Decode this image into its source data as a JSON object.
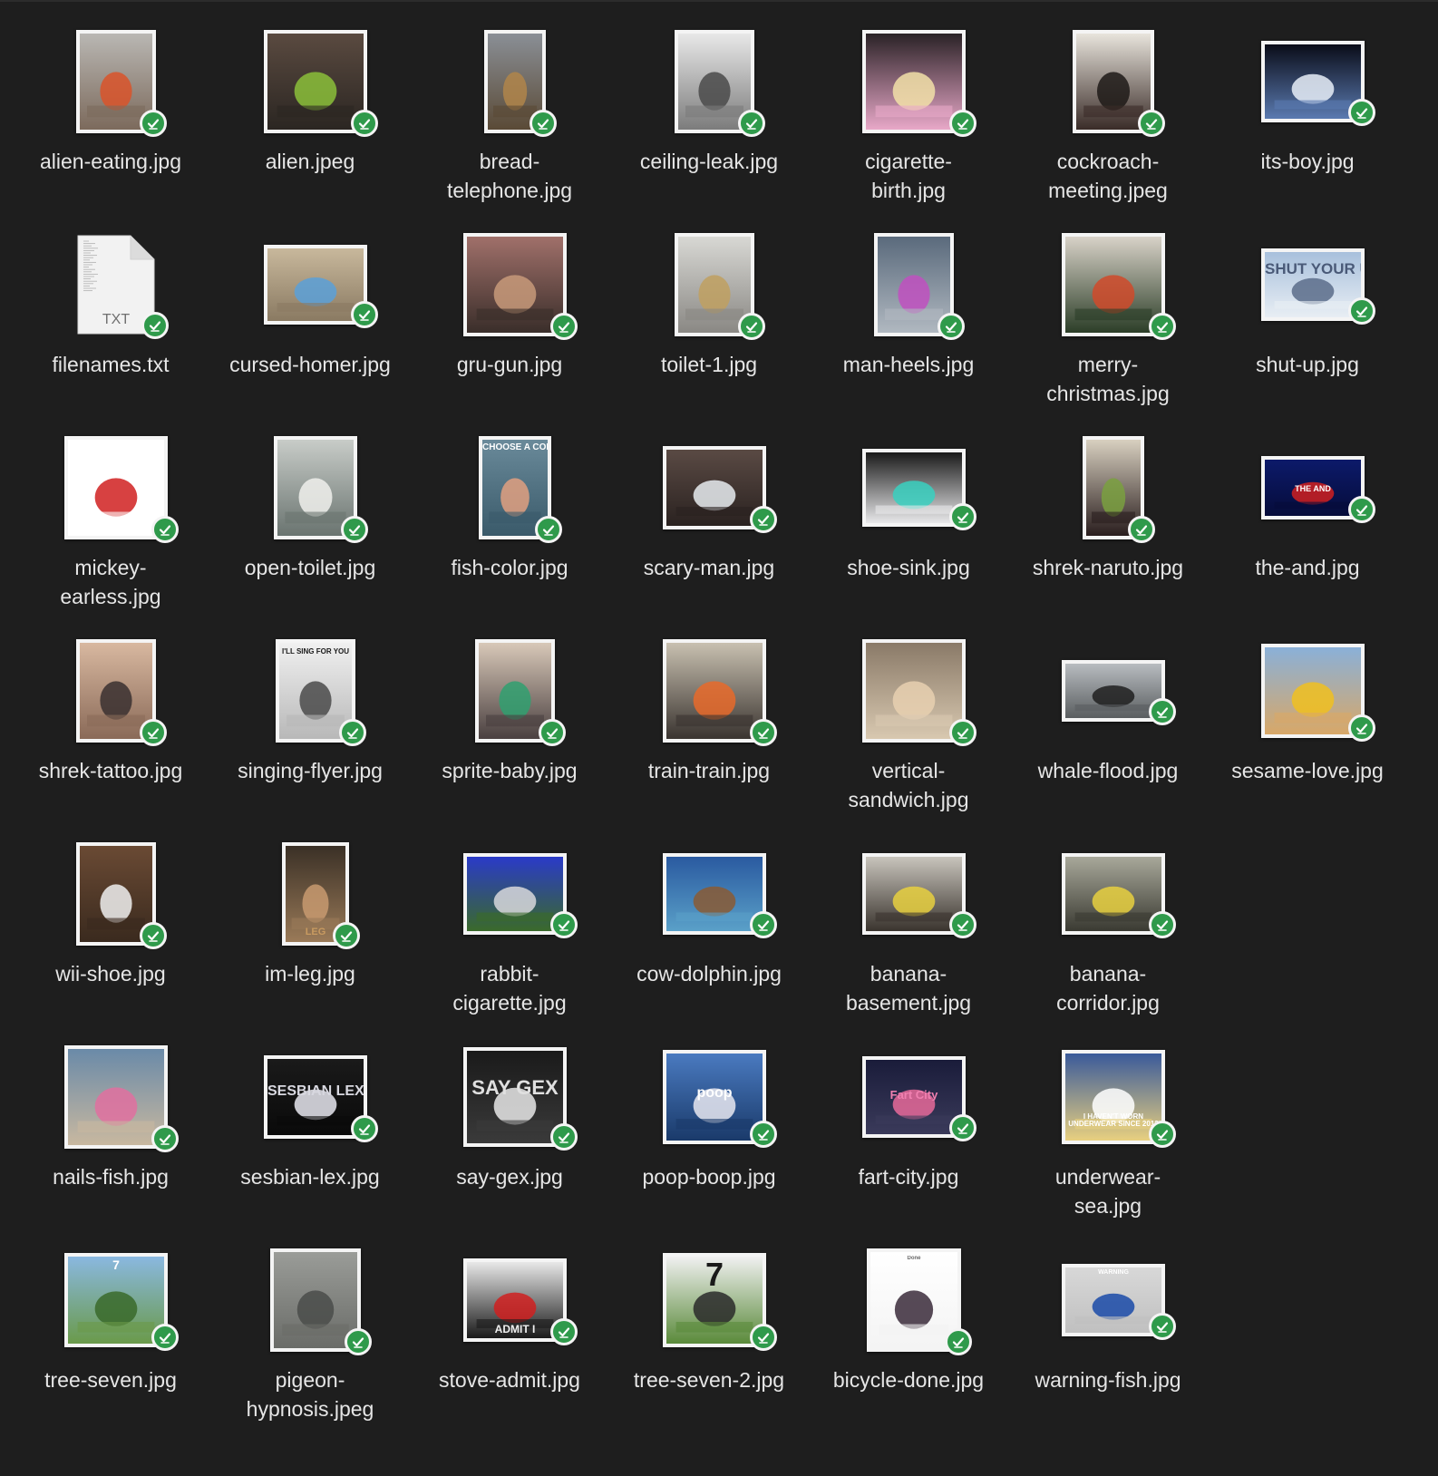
{
  "window": {
    "background": "#1e1e1e"
  },
  "files": [
    {
      "name": "alien-eating.jpg",
      "display": "alien-eating.jpg",
      "w": 88,
      "h": 114,
      "bg": [
        "#b9b7b3",
        "#7c6a5c"
      ],
      "accent": "#d9542a",
      "icon": "alien-eating-thumbnail",
      "selected": true
    },
    {
      "name": "alien.jpeg",
      "display": "alien.jpeg",
      "w": 114,
      "h": 114,
      "bg": [
        "#5a4a40",
        "#2b2622"
      ],
      "accent": "#8bbf3a",
      "icon": "alien-thumbnail",
      "selected": true
    },
    {
      "name": "bread-telephone.jpg",
      "display": "bread-\ntelephone.jpg",
      "w": 68,
      "h": 114,
      "bg": [
        "#8a8f96",
        "#5a4a36"
      ],
      "accent": "#b0854a",
      "icon": "bread-telephone-thumbnail",
      "selected": true
    },
    {
      "name": "ceiling-leak.jpg",
      "display": "ceiling-leak.jpg",
      "w": 88,
      "h": 114,
      "bg": [
        "#e8e8e8",
        "#7c7c7c"
      ],
      "accent": "#4a4a4a",
      "icon": "ceiling-leak-thumbnail",
      "selected": true
    },
    {
      "name": "cigarette-birth.jpg",
      "display": "cigarette-\nbirth.jpg",
      "w": 114,
      "h": 114,
      "bg": [
        "#2a2226",
        "#e8a8c8"
      ],
      "accent": "#f2e0a8",
      "icon": "cigarette-birth-thumbnail",
      "selected": true
    },
    {
      "name": "cockroach-meeting.jpeg",
      "display": "cockroach-\nmeeting.jpeg",
      "w": 90,
      "h": 114,
      "bg": [
        "#e8e4dc",
        "#3a2c28"
      ],
      "accent": "#1e1a18",
      "icon": "cockroach-meeting-thumbnail",
      "selected": true
    },
    {
      "name": "its-boy.jpg",
      "display": "its-boy.jpg",
      "w": 114,
      "h": 90,
      "bg": [
        "#0a0c18",
        "#5a7ab0"
      ],
      "accent": "#e8eef8",
      "icon": "its-boy-thumbnail",
      "selected": true
    },
    {
      "name": "filenames.txt",
      "display": "filenames.txt",
      "type": "txt",
      "ext": "TXT",
      "icon": "text-document-icon",
      "selected": true
    },
    {
      "name": "cursed-homer.jpg",
      "display": "cursed-homer.jpg",
      "w": 114,
      "h": 88,
      "bg": [
        "#c8b89c",
        "#8a7a62"
      ],
      "accent": "#5aa0d8",
      "icon": "cursed-homer-thumbnail",
      "selected": true
    },
    {
      "name": "gru-gun.jpg",
      "display": "gru-gun.jpg",
      "w": 114,
      "h": 114,
      "bg": [
        "#a0706a",
        "#3a2e2a"
      ],
      "accent": "#c89a7a",
      "icon": "gru-gun-thumbnail",
      "selected": true
    },
    {
      "name": "toilet-1.jpg",
      "display": "toilet-1.jpg",
      "w": 88,
      "h": 114,
      "bg": [
        "#d8d8d4",
        "#8a8884"
      ],
      "accent": "#c0a060",
      "icon": "toilet-thumbnail",
      "selected": true
    },
    {
      "name": "man-heels.jpg",
      "display": "man-heels.jpg",
      "w": 88,
      "h": 114,
      "bg": [
        "#5a6a7c",
        "#b0b8c0"
      ],
      "accent": "#c050c0",
      "icon": "man-heels-thumbnail",
      "selected": true
    },
    {
      "name": "merry-christmas.jpg",
      "display": "merry-\nchristmas.jpg",
      "w": 114,
      "h": 114,
      "bg": [
        "#d8d2c8",
        "#2c3e28"
      ],
      "accent": "#d04a2a",
      "icon": "merry-christmas-thumbnail",
      "selected": true
    },
    {
      "name": "shut-up.jpg",
      "display": "shut-up.jpg",
      "w": 114,
      "h": 80,
      "bg": [
        "#a8c0dc",
        "#e8eef4"
      ],
      "accent": "#5a6c8a",
      "icon": "shut-up-thumbnail",
      "label": "SHUT YOUR UP",
      "labelColor": "#4a5a78",
      "labelSize": 17,
      "labelTop": 10,
      "selected": true
    },
    {
      "name": "mickey-earless.jpg",
      "display": "mickey-\nearless.jpg",
      "w": 114,
      "h": 114,
      "bg": [
        "#ffffff",
        "#ffffff"
      ],
      "accent": "#d02020",
      "icon": "mickey-earless-thumbnail",
      "selected": true
    },
    {
      "name": "open-toilet.jpg",
      "display": "open-toilet.jpg",
      "w": 92,
      "h": 114,
      "bg": [
        "#c8ccc8",
        "#6a7470"
      ],
      "accent": "#f0f0ec",
      "icon": "open-toilet-thumbnail",
      "selected": true
    },
    {
      "name": "fish-color.jpg",
      "display": "fish-color.jpg",
      "w": 80,
      "h": 114,
      "bg": [
        "#6a8a9a",
        "#3a5a6a"
      ],
      "accent": "#e0a080",
      "icon": "fish-color-thumbnail",
      "label": "CHOOSE A COLOR",
      "labelColor": "#ffffff",
      "labelSize": 10,
      "labelTop": 4,
      "selected": true
    },
    {
      "name": "scary-man.jpg",
      "display": "scary-man.jpg",
      "w": 114,
      "h": 92,
      "bg": [
        "#5a4a44",
        "#2a2220"
      ],
      "accent": "#e8ecf0",
      "icon": "scary-man-thumbnail",
      "selected": true
    },
    {
      "name": "shoe-sink.jpg",
      "display": "shoe-sink.jpg",
      "w": 114,
      "h": 86,
      "bg": [
        "#1a1a1a",
        "#e8e8ea"
      ],
      "accent": "#38d0c0",
      "icon": "shoe-sink-thumbnail",
      "selected": true
    },
    {
      "name": "shrek-naruto.jpg",
      "display": "shrek-naruto.jpg",
      "w": 68,
      "h": 114,
      "bg": [
        "#d8d0c0",
        "#2a1e1e"
      ],
      "accent": "#7aa040",
      "icon": "shrek-naruto-thumbnail",
      "selected": true
    },
    {
      "name": "the-and.jpg",
      "display": "the-and.jpg",
      "w": 114,
      "h": 70,
      "bg": [
        "#0c1a6a",
        "#060c3a"
      ],
      "accent": "#d02020",
      "icon": "the-and-thumbnail",
      "label": "THE AND",
      "labelColor": "#ffffff",
      "labelSize": 9,
      "labelTop": 28,
      "selected": true
    },
    {
      "name": "shrek-tattoo.jpg",
      "display": "shrek-tattoo.jpg",
      "w": 88,
      "h": 114,
      "bg": [
        "#d8b8a0",
        "#8a6a58"
      ],
      "accent": "#3a3030",
      "icon": "shrek-tattoo-thumbnail",
      "selected": true
    },
    {
      "name": "singing-flyer.jpg",
      "display": "singing-flyer.jpg",
      "w": 88,
      "h": 114,
      "bg": [
        "#f0f0f0",
        "#b8b8b8"
      ],
      "accent": "#4a4a4a",
      "icon": "singing-flyer-thumbnail",
      "label": "I'LL SING FOR YOU",
      "labelColor": "#1a1a1a",
      "labelSize": 8,
      "labelTop": 6,
      "selected": true
    },
    {
      "name": "sprite-baby.jpg",
      "display": "sprite-baby.jpg",
      "w": 88,
      "h": 114,
      "bg": [
        "#d8c8b8",
        "#4a4040"
      ],
      "accent": "#30a070",
      "icon": "sprite-baby-thumbnail",
      "selected": true
    },
    {
      "name": "train-train.jpg",
      "display": "train-train.jpg",
      "w": 114,
      "h": 114,
      "bg": [
        "#c8c0b0",
        "#3a3430"
      ],
      "accent": "#e86a2a",
      "icon": "train-train-thumbnail",
      "selected": true
    },
    {
      "name": "vertical-sandwich.jpg",
      "display": "vertical-\nsandwich.jpg",
      "w": 114,
      "h": 114,
      "bg": [
        "#8a7a68",
        "#d8c8b0"
      ],
      "accent": "#e8d0b0",
      "icon": "vertical-sandwich-thumbnail",
      "selected": true
    },
    {
      "name": "whale-flood.jpg",
      "display": "whale-flood.jpg",
      "w": 114,
      "h": 68,
      "bg": [
        "#b8bcc0",
        "#5a5e60"
      ],
      "accent": "#202020",
      "icon": "whale-flood-thumbnail",
      "selected": true
    },
    {
      "name": "sesame-love.jpg",
      "display": "sesame-love.jpg",
      "w": 114,
      "h": 104,
      "bg": [
        "#8ab0d8",
        "#d8a868"
      ],
      "accent": "#f0c020",
      "icon": "sesame-love-thumbnail",
      "selected": true
    },
    {
      "name": "wii-shoe.jpg",
      "display": "wii-shoe.jpg",
      "w": 88,
      "h": 114,
      "bg": [
        "#6a4a34",
        "#3a2a1e"
      ],
      "accent": "#f0f0f0",
      "icon": "wii-shoe-thumbnail",
      "selected": true
    },
    {
      "name": "im-leg.jpg",
      "display": "im-leg.jpg",
      "w": 74,
      "h": 114,
      "bg": [
        "#3a3026",
        "#9a7a58"
      ],
      "accent": "#c89a70",
      "icon": "im-leg-thumbnail",
      "label": "LEG",
      "labelColor": "#c89a60",
      "labelSize": 11,
      "labelTop": 90,
      "selected": true
    },
    {
      "name": "rabbit-cigarette.jpg",
      "display": "rabbit-\ncigarette.jpg",
      "w": 114,
      "h": 90,
      "bg": [
        "#2a3ac8",
        "#3a6a2a"
      ],
      "accent": "#d8d8dc",
      "icon": "rabbit-cigarette-thumbnail",
      "selected": true
    },
    {
      "name": "cow-dolphin.jpg",
      "display": "cow-dolphin.jpg",
      "w": 114,
      "h": 90,
      "bg": [
        "#2a5aa0",
        "#5aa0c8"
      ],
      "accent": "#8a5a34",
      "icon": "cow-dolphin-thumbnail",
      "selected": true
    },
    {
      "name": "banana-basement.jpg",
      "display": "banana-\nbasement.jpg",
      "w": 114,
      "h": 90,
      "bg": [
        "#c8c4bc",
        "#3a342e"
      ],
      "accent": "#e8d040",
      "icon": "banana-basement-thumbnail",
      "selected": true
    },
    {
      "name": "banana-corridor.jpg",
      "display": "banana-\ncorridor.jpg",
      "w": 114,
      "h": 90,
      "bg": [
        "#a8a89a",
        "#3a3a32"
      ],
      "accent": "#e8d040",
      "icon": "banana-corridor-thumbnail",
      "selected": true
    },
    {
      "name": "_empty1",
      "display": "",
      "empty": true
    },
    {
      "name": "nails-fish.jpg",
      "display": "nails-fish.jpg",
      "w": 114,
      "h": 114,
      "bg": [
        "#6a8aa8",
        "#c8b8a0"
      ],
      "accent": "#e070a0",
      "icon": "nails-fish-thumbnail",
      "selected": true
    },
    {
      "name": "sesbian-lex.jpg",
      "display": "sesbian-lex.jpg",
      "w": 114,
      "h": 92,
      "bg": [
        "#1a1a1a",
        "#0a0a0a"
      ],
      "accent": "#e8e8f0",
      "icon": "sesbian-lex-thumbnail",
      "label": "SESBIAN LEX",
      "labelColor": "#d8d8e0",
      "labelSize": 16,
      "labelTop": 28,
      "selected": true
    },
    {
      "name": "say-gex.jpg",
      "display": "say-gex.jpg",
      "w": 114,
      "h": 110,
      "bg": [
        "#1a1a1a",
        "#3a3a3a"
      ],
      "accent": "#e8e8e8",
      "icon": "say-gex-thumbnail",
      "label": "SAY GEX",
      "labelColor": "#e0e0e0",
      "labelSize": 22,
      "labelTop": 30,
      "selected": true
    },
    {
      "name": "poop-boop.jpg",
      "display": "poop-boop.jpg",
      "w": 114,
      "h": 104,
      "bg": [
        "#4a7ac0",
        "#1a3a6a"
      ],
      "accent": "#e8e8f0",
      "icon": "poop-boop-thumbnail",
      "label": "poop",
      "labelColor": "#ffffff",
      "labelSize": 16,
      "labelTop": 36,
      "selected": true
    },
    {
      "name": "fart-city.jpg",
      "display": "fart-city.jpg",
      "w": 114,
      "h": 90,
      "bg": [
        "#1a1c3a",
        "#3a3a5a"
      ],
      "accent": "#e86a9a",
      "icon": "fart-city-thumbnail",
      "label": "Fart City",
      "labelColor": "#f080b0",
      "labelSize": 13,
      "labelTop": 32,
      "selected": true
    },
    {
      "name": "underwear-sea.jpg",
      "display": "underwear-\nsea.jpg",
      "w": 114,
      "h": 104,
      "bg": [
        "#3a5a9a",
        "#e8d080"
      ],
      "accent": "#ffffff",
      "icon": "underwear-sea-thumbnail",
      "label": "I HAVEN'T WORN UNDERWEAR SINCE 2012",
      "labelColor": "#ffffff",
      "labelSize": 8,
      "labelTop": 66,
      "selected": true
    },
    {
      "name": "_empty2",
      "display": "",
      "empty": true
    },
    {
      "name": "tree-seven.jpg",
      "display": "tree-seven.jpg",
      "w": 114,
      "h": 104,
      "bg": [
        "#8ab8e0",
        "#6a9a4a"
      ],
      "accent": "#3a6a2a",
      "icon": "tree-seven-thumbnail",
      "label": "7",
      "labelColor": "#ffffff",
      "labelSize": 14,
      "labelTop": 2,
      "selected": true
    },
    {
      "name": "pigeon-hypnosis.jpeg",
      "display": "pigeon-\nhypnosis.jpeg",
      "w": 100,
      "h": 114,
      "bg": [
        "#9a9c98",
        "#6a6c68"
      ],
      "accent": "#4a4c4a",
      "icon": "pigeon-hypnosis-thumbnail",
      "selected": true
    },
    {
      "name": "stove-admit.jpg",
      "display": "stove-admit.jpg",
      "w": 114,
      "h": 92,
      "bg": [
        "#e8e8e8",
        "#1a1a1a"
      ],
      "accent": "#d02020",
      "icon": "stove-admit-thumbnail",
      "label": "ADMIT I",
      "labelColor": "#f0f0f0",
      "labelSize": 12,
      "labelTop": 68,
      "selected": true
    },
    {
      "name": "tree-seven-2.jpg",
      "display": "tree-seven-2.jpg",
      "w": 114,
      "h": 104,
      "bg": [
        "#f0f0f0",
        "#5a8a3a"
      ],
      "accent": "#2a2a2a",
      "icon": "tree-seven-2-thumbnail",
      "label": "7",
      "labelColor": "#1a1a1a",
      "labelSize": 36,
      "labelTop": 2,
      "selected": true
    },
    {
      "name": "bicycle-done.jpg",
      "display": "bicycle-done.jpg",
      "w": 104,
      "h": 114,
      "bg": [
        "#ffffff",
        "#f4f4f4"
      ],
      "accent": "#3a2a3a",
      "icon": "bicycle-done-thumbnail",
      "label": "Done",
      "labelColor": "#6a6a6a",
      "labelSize": 6,
      "labelTop": 4,
      "selected": true
    },
    {
      "name": "warning-fish.jpg",
      "display": "warning-fish.jpg",
      "w": 114,
      "h": 80,
      "bg": [
        "#d8d8d8",
        "#c0c0c0"
      ],
      "accent": "#1a4aa8",
      "icon": "warning-fish-thumbnail",
      "label": "WARNING",
      "labelColor": "#ffffff",
      "labelSize": 7,
      "labelTop": 2,
      "selected": true
    },
    {
      "name": "_empty3",
      "display": "",
      "empty": true
    }
  ],
  "badge": {
    "color": "#2f9a4b",
    "icon": "checkmark-icon"
  }
}
